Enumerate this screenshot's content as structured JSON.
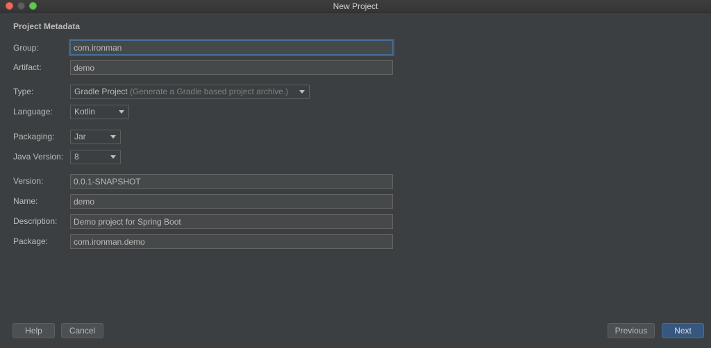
{
  "window": {
    "title": "New Project"
  },
  "section": {
    "title": "Project Metadata"
  },
  "fields": {
    "group": {
      "label": "Group:",
      "value": "com.ironman"
    },
    "artifact": {
      "label": "Artifact:",
      "value": "demo"
    },
    "type": {
      "label": "Type:",
      "value": "Gradle Project",
      "hint": "(Generate a Gradle based project archive.)"
    },
    "language": {
      "label": "Language:",
      "value": "Kotlin"
    },
    "packaging": {
      "label": "Packaging:",
      "value": "Jar"
    },
    "java_version": {
      "label": "Java Version:",
      "value": "8"
    },
    "version": {
      "label": "Version:",
      "value": "0.0.1-SNAPSHOT"
    },
    "name": {
      "label": "Name:",
      "value": "demo"
    },
    "description": {
      "label": "Description:",
      "value": "Demo project for Spring Boot"
    },
    "package": {
      "label": "Package:",
      "value": "com.ironman.demo"
    }
  },
  "buttons": {
    "help": "Help",
    "cancel": "Cancel",
    "previous": "Previous",
    "next": "Next"
  },
  "colors": {
    "background": "#3c3f41",
    "focus_ring": "#3d6185",
    "primary_button": "#365880"
  },
  "icons": {
    "close": "close-icon",
    "minimize": "minimize-icon",
    "zoom": "zoom-icon",
    "dropdown": "chevron-down-icon"
  }
}
